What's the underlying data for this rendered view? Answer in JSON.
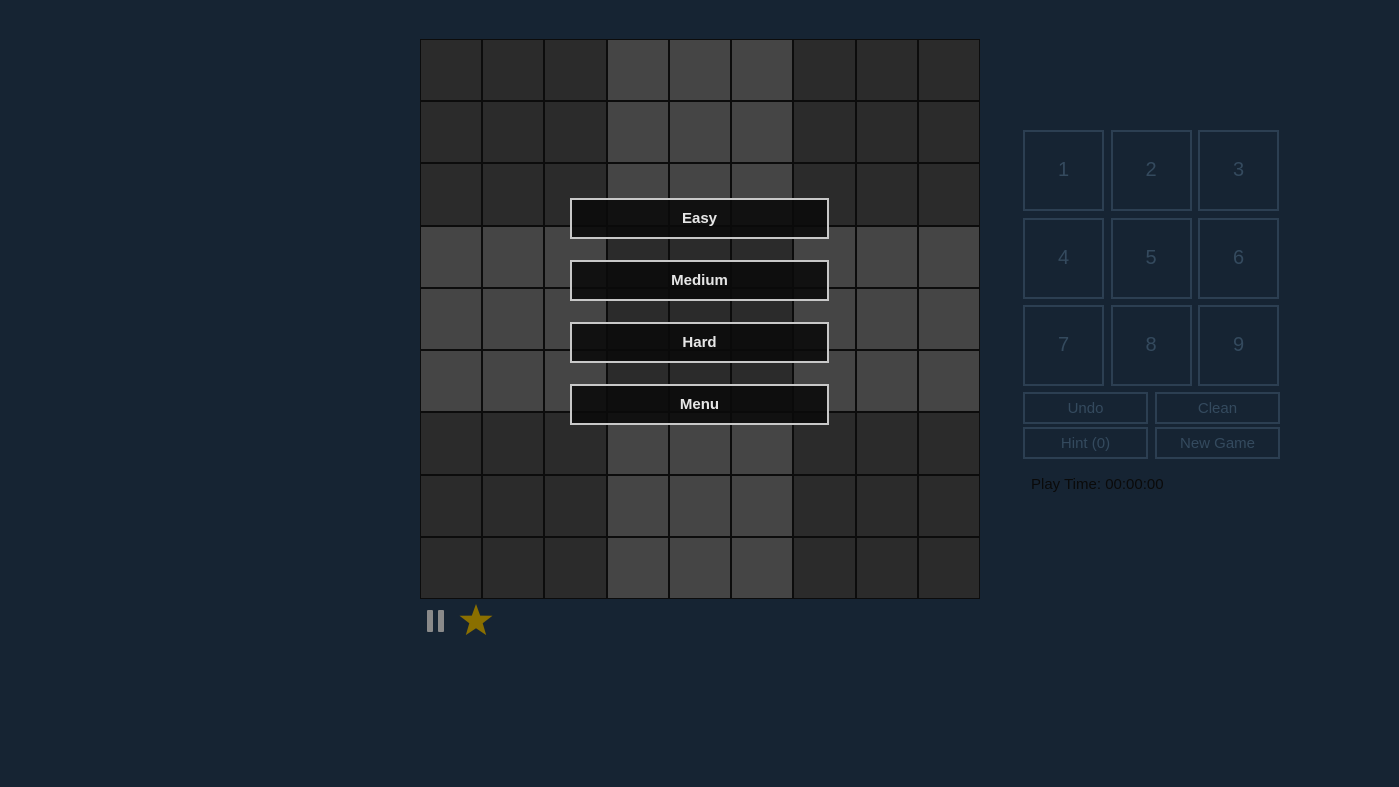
{
  "menu": {
    "easy": "Easy",
    "medium": "Medium",
    "hard": "Hard",
    "menu": "Menu"
  },
  "numpad": [
    "1",
    "2",
    "3",
    "4",
    "5",
    "6",
    "7",
    "8",
    "9"
  ],
  "actions": {
    "undo": "Undo",
    "clean": "Clean",
    "hint": "Hint (0)",
    "new_game": "New Game"
  },
  "status": {
    "play_time_label": "Play Time:",
    "play_time_value": "00:00:00"
  },
  "icons": {
    "pause": "pause-icon",
    "favorite": "star-icon"
  },
  "colors": {
    "background": "#162433",
    "star": "#8a6f00",
    "cell_dark": "#2b2b2b",
    "cell_light": "#454545"
  }
}
